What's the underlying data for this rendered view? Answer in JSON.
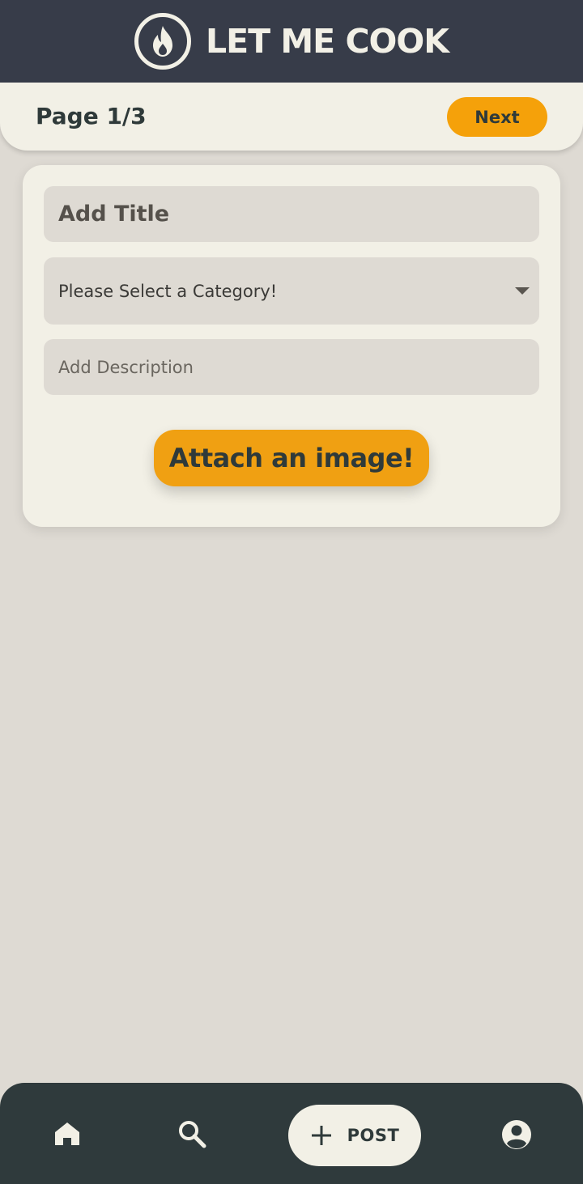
{
  "header": {
    "app_title": "LET ME COOK",
    "logo_icon": "flame-icon"
  },
  "pagebar": {
    "page_label": "Page 1/3",
    "next_label": "Next"
  },
  "form": {
    "title_placeholder": "Add Title",
    "category_value": "Please Select a Category!",
    "description_placeholder": "Add Description",
    "attach_label": "Attach an image!"
  },
  "bottom_nav": {
    "items": [
      {
        "icon": "home-icon"
      },
      {
        "icon": "search-icon"
      },
      {
        "icon": "plus-icon",
        "label": "POST"
      },
      {
        "icon": "account-circle-icon"
      }
    ]
  },
  "colors": {
    "header_bg": "#373c49",
    "nav_bg": "#2f3a3c",
    "accent": "#f5a10a",
    "surface": "#f2f0e6",
    "background": "#dedad3"
  }
}
